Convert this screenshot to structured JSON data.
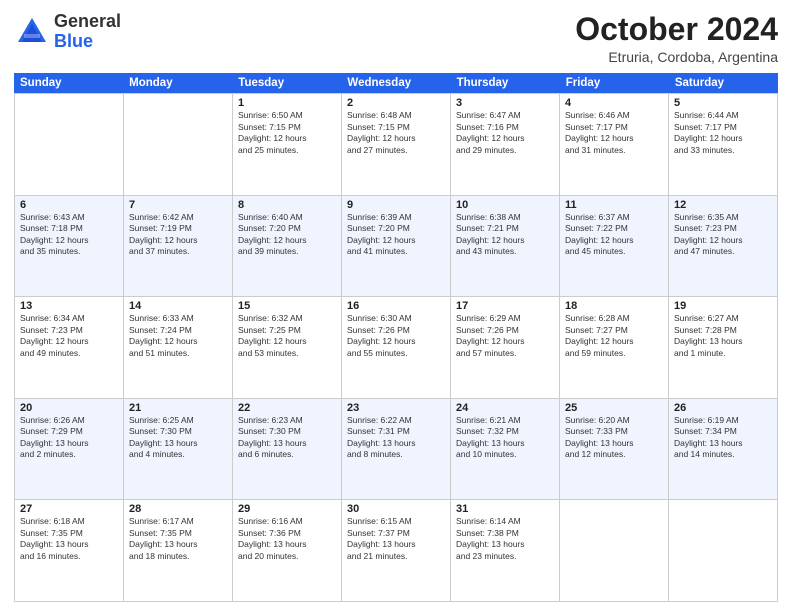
{
  "header": {
    "logo_general": "General",
    "logo_blue": "Blue",
    "month_title": "October 2024",
    "location": "Etruria, Cordoba, Argentina"
  },
  "days_of_week": [
    "Sunday",
    "Monday",
    "Tuesday",
    "Wednesday",
    "Thursday",
    "Friday",
    "Saturday"
  ],
  "weeks": [
    [
      {
        "day": "",
        "info": ""
      },
      {
        "day": "",
        "info": ""
      },
      {
        "day": "1",
        "info": "Sunrise: 6:50 AM\nSunset: 7:15 PM\nDaylight: 12 hours\nand 25 minutes."
      },
      {
        "day": "2",
        "info": "Sunrise: 6:48 AM\nSunset: 7:15 PM\nDaylight: 12 hours\nand 27 minutes."
      },
      {
        "day": "3",
        "info": "Sunrise: 6:47 AM\nSunset: 7:16 PM\nDaylight: 12 hours\nand 29 minutes."
      },
      {
        "day": "4",
        "info": "Sunrise: 6:46 AM\nSunset: 7:17 PM\nDaylight: 12 hours\nand 31 minutes."
      },
      {
        "day": "5",
        "info": "Sunrise: 6:44 AM\nSunset: 7:17 PM\nDaylight: 12 hours\nand 33 minutes."
      }
    ],
    [
      {
        "day": "6",
        "info": "Sunrise: 6:43 AM\nSunset: 7:18 PM\nDaylight: 12 hours\nand 35 minutes."
      },
      {
        "day": "7",
        "info": "Sunrise: 6:42 AM\nSunset: 7:19 PM\nDaylight: 12 hours\nand 37 minutes."
      },
      {
        "day": "8",
        "info": "Sunrise: 6:40 AM\nSunset: 7:20 PM\nDaylight: 12 hours\nand 39 minutes."
      },
      {
        "day": "9",
        "info": "Sunrise: 6:39 AM\nSunset: 7:20 PM\nDaylight: 12 hours\nand 41 minutes."
      },
      {
        "day": "10",
        "info": "Sunrise: 6:38 AM\nSunset: 7:21 PM\nDaylight: 12 hours\nand 43 minutes."
      },
      {
        "day": "11",
        "info": "Sunrise: 6:37 AM\nSunset: 7:22 PM\nDaylight: 12 hours\nand 45 minutes."
      },
      {
        "day": "12",
        "info": "Sunrise: 6:35 AM\nSunset: 7:23 PM\nDaylight: 12 hours\nand 47 minutes."
      }
    ],
    [
      {
        "day": "13",
        "info": "Sunrise: 6:34 AM\nSunset: 7:23 PM\nDaylight: 12 hours\nand 49 minutes."
      },
      {
        "day": "14",
        "info": "Sunrise: 6:33 AM\nSunset: 7:24 PM\nDaylight: 12 hours\nand 51 minutes."
      },
      {
        "day": "15",
        "info": "Sunrise: 6:32 AM\nSunset: 7:25 PM\nDaylight: 12 hours\nand 53 minutes."
      },
      {
        "day": "16",
        "info": "Sunrise: 6:30 AM\nSunset: 7:26 PM\nDaylight: 12 hours\nand 55 minutes."
      },
      {
        "day": "17",
        "info": "Sunrise: 6:29 AM\nSunset: 7:26 PM\nDaylight: 12 hours\nand 57 minutes."
      },
      {
        "day": "18",
        "info": "Sunrise: 6:28 AM\nSunset: 7:27 PM\nDaylight: 12 hours\nand 59 minutes."
      },
      {
        "day": "19",
        "info": "Sunrise: 6:27 AM\nSunset: 7:28 PM\nDaylight: 13 hours\nand 1 minute."
      }
    ],
    [
      {
        "day": "20",
        "info": "Sunrise: 6:26 AM\nSunset: 7:29 PM\nDaylight: 13 hours\nand 2 minutes."
      },
      {
        "day": "21",
        "info": "Sunrise: 6:25 AM\nSunset: 7:30 PM\nDaylight: 13 hours\nand 4 minutes."
      },
      {
        "day": "22",
        "info": "Sunrise: 6:23 AM\nSunset: 7:30 PM\nDaylight: 13 hours\nand 6 minutes."
      },
      {
        "day": "23",
        "info": "Sunrise: 6:22 AM\nSunset: 7:31 PM\nDaylight: 13 hours\nand 8 minutes."
      },
      {
        "day": "24",
        "info": "Sunrise: 6:21 AM\nSunset: 7:32 PM\nDaylight: 13 hours\nand 10 minutes."
      },
      {
        "day": "25",
        "info": "Sunrise: 6:20 AM\nSunset: 7:33 PM\nDaylight: 13 hours\nand 12 minutes."
      },
      {
        "day": "26",
        "info": "Sunrise: 6:19 AM\nSunset: 7:34 PM\nDaylight: 13 hours\nand 14 minutes."
      }
    ],
    [
      {
        "day": "27",
        "info": "Sunrise: 6:18 AM\nSunset: 7:35 PM\nDaylight: 13 hours\nand 16 minutes."
      },
      {
        "day": "28",
        "info": "Sunrise: 6:17 AM\nSunset: 7:35 PM\nDaylight: 13 hours\nand 18 minutes."
      },
      {
        "day": "29",
        "info": "Sunrise: 6:16 AM\nSunset: 7:36 PM\nDaylight: 13 hours\nand 20 minutes."
      },
      {
        "day": "30",
        "info": "Sunrise: 6:15 AM\nSunset: 7:37 PM\nDaylight: 13 hours\nand 21 minutes."
      },
      {
        "day": "31",
        "info": "Sunrise: 6:14 AM\nSunset: 7:38 PM\nDaylight: 13 hours\nand 23 minutes."
      },
      {
        "day": "",
        "info": ""
      },
      {
        "day": "",
        "info": ""
      }
    ]
  ]
}
